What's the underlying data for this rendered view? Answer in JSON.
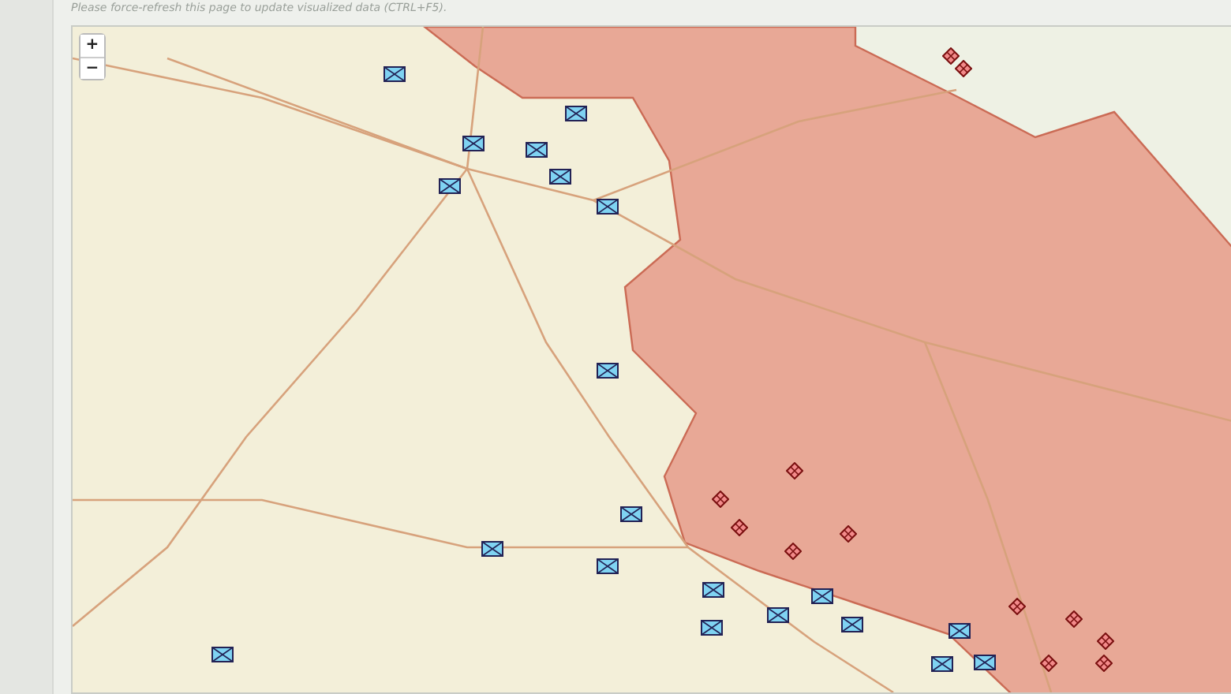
{
  "notice": "Please force-refresh this page to update visualized data (CTRL+F5).",
  "map": {
    "zoom_in": "+",
    "zoom_out": "−"
  }
}
